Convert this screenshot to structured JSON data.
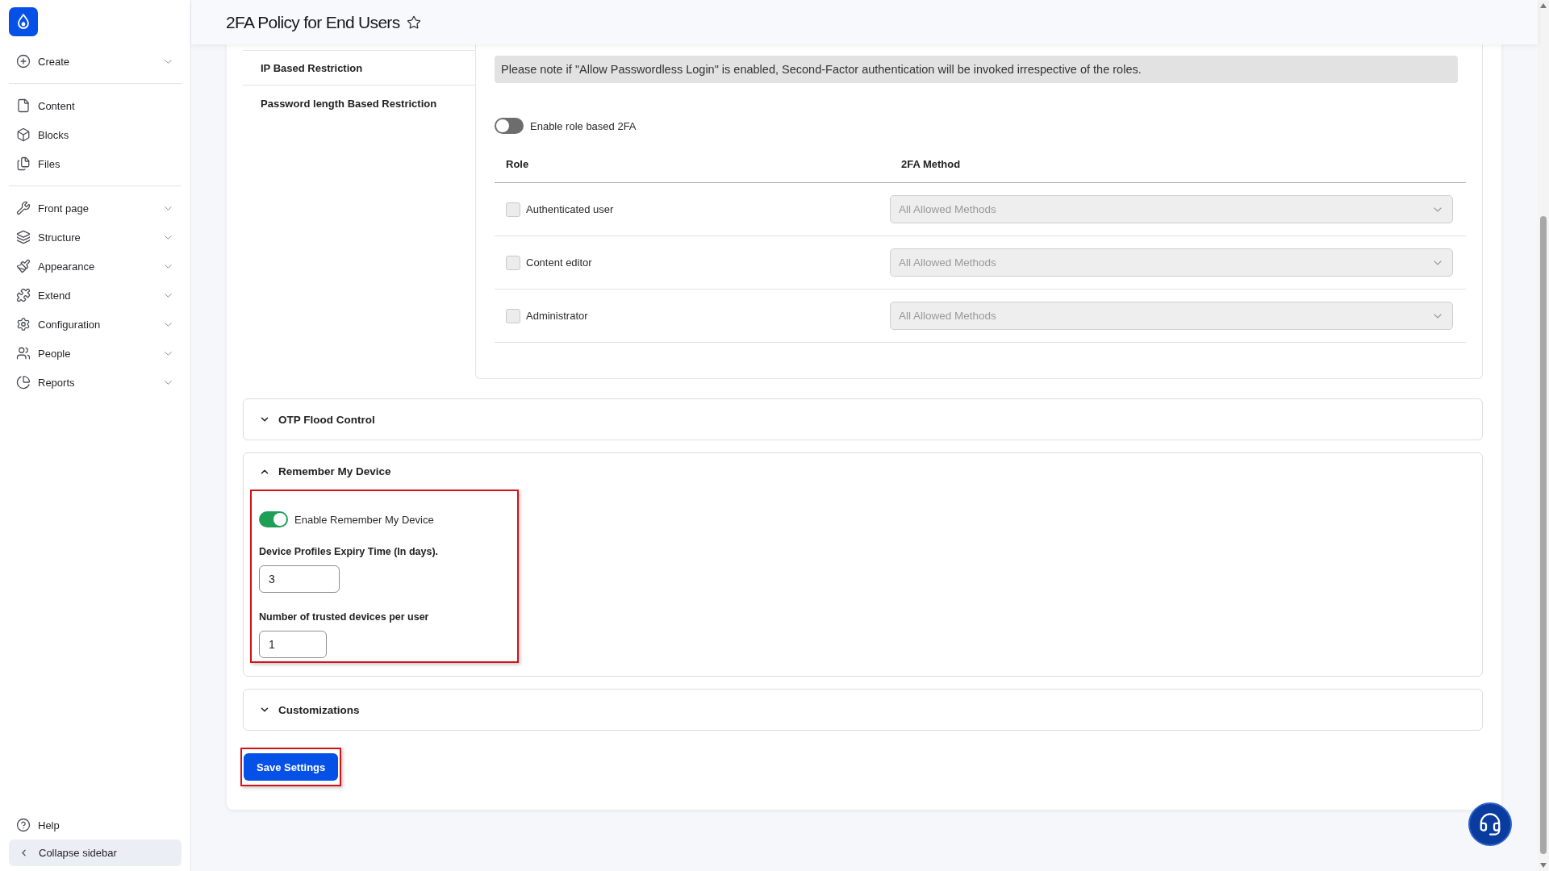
{
  "sidebar": {
    "groups": [
      {
        "items": [
          {
            "label": "Create",
            "has_submenu": true
          }
        ]
      },
      {
        "items": [
          {
            "label": "Content",
            "has_submenu": false
          },
          {
            "label": "Blocks",
            "has_submenu": false
          },
          {
            "label": "Files",
            "has_submenu": false
          }
        ]
      },
      {
        "items": [
          {
            "label": "Front page",
            "has_submenu": true
          },
          {
            "label": "Structure",
            "has_submenu": true
          },
          {
            "label": "Appearance",
            "has_submenu": true
          },
          {
            "label": "Extend",
            "has_submenu": true
          },
          {
            "label": "Configuration",
            "has_submenu": true
          },
          {
            "label": "People",
            "has_submenu": true
          },
          {
            "label": "Reports",
            "has_submenu": true
          }
        ]
      }
    ],
    "help": {
      "label": "Help"
    },
    "collapse": {
      "label": "Collapse sidebar"
    }
  },
  "header": {
    "title": "2FA Policy for End Users",
    "starred": false
  },
  "policy_tabs": [
    {
      "label": "IP Based Restriction",
      "selected": false
    },
    {
      "label": "Password length Based Restriction",
      "selected": false
    }
  ],
  "role_panel": {
    "note": "Please note if \"Allow Passwordless Login\" is enabled, Second-Factor authentication will be invoked irrespective of the roles.",
    "toggle": {
      "label": "Enable role based 2FA",
      "on": false
    },
    "columns": [
      "Role",
      "2FA Method"
    ],
    "rows": [
      {
        "role": "Authenticated user",
        "checked": false,
        "method": "All Allowed Methods",
        "disabled": true
      },
      {
        "role": "Content editor",
        "checked": false,
        "method": "All Allowed Methods",
        "disabled": true
      },
      {
        "role": "Administrator",
        "checked": false,
        "method": "All Allowed Methods",
        "disabled": true
      }
    ]
  },
  "sections": [
    {
      "title": "OTP Flood Control",
      "expanded": false
    },
    {
      "title": "Remember My Device",
      "expanded": true,
      "highlighted": true,
      "toggle": {
        "label": "Enable Remember My Device",
        "on": true
      },
      "fields": [
        {
          "label": "Device Profiles Expiry Time (In days).",
          "value": "3"
        },
        {
          "label": "Number of trusted devices per user",
          "value": "1"
        }
      ]
    },
    {
      "title": "Customizations",
      "expanded": false
    }
  ],
  "save_button": {
    "label": "Save Settings",
    "highlighted": true
  }
}
